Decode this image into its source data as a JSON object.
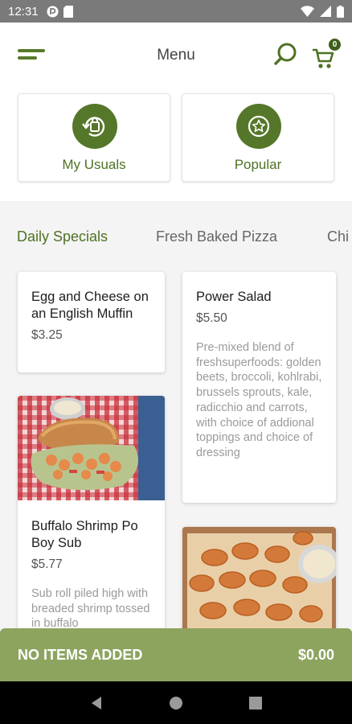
{
  "status": {
    "time": "12:31"
  },
  "header": {
    "title": "Menu",
    "cart_count": "0"
  },
  "quick": [
    {
      "label": "My Usuals",
      "icon": "bag-refresh-icon"
    },
    {
      "label": "Popular",
      "icon": "star-icon"
    }
  ],
  "tabs": [
    "Daily Specials",
    "Fresh Baked Pizza",
    "Chi"
  ],
  "items": [
    {
      "name": "Egg and Cheese on an English Muffin",
      "price": "$3.25",
      "desc": ""
    },
    {
      "name": "Power Salad",
      "price": "$5.50",
      "desc": "Pre-mixed blend of freshsuperfoods: golden beets, broccoli, kohlrabi, brussels sprouts, kale, radicchio and carrots, with choice of addional toppings and choice of dressing"
    },
    {
      "name": "Buffalo Shrimp Po Boy Sub",
      "price": "$5.77",
      "desc": "Sub roll piled high with breaded shrimp tossed in buffalo"
    }
  ],
  "cart_bar": {
    "label": "NO ITEMS ADDED",
    "total": "$0.00"
  },
  "colors": {
    "brand_green": "#55772a",
    "cart_bar": "#8da45f"
  }
}
